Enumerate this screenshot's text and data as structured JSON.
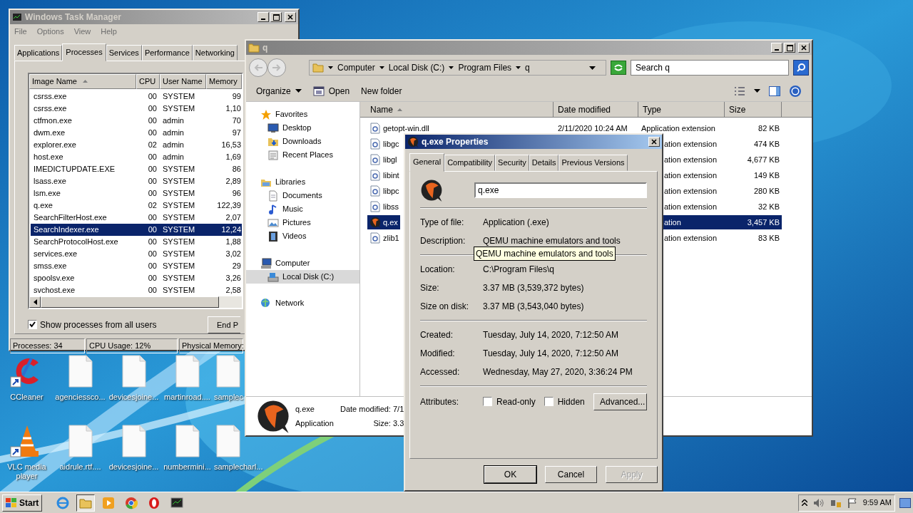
{
  "task_manager": {
    "title": "Windows Task Manager",
    "active": false,
    "menu": [
      "File",
      "Options",
      "View",
      "Help"
    ],
    "tabs": [
      {
        "label": "Applications",
        "selected": false
      },
      {
        "label": "Processes",
        "selected": true
      },
      {
        "label": "Services",
        "selected": false
      },
      {
        "label": "Performance",
        "selected": false
      },
      {
        "label": "Networking",
        "selected": false
      }
    ],
    "columns": [
      "Image Name",
      "CPU",
      "User Name",
      "Memory"
    ],
    "rows": [
      {
        "cells": [
          "csrss.exe",
          "00",
          "SYSTEM",
          "99"
        ],
        "selected": false
      },
      {
        "cells": [
          "csrss.exe",
          "00",
          "SYSTEM",
          "1,10"
        ],
        "selected": false
      },
      {
        "cells": [
          "ctfmon.exe",
          "00",
          "admin",
          "70"
        ],
        "selected": false
      },
      {
        "cells": [
          "dwm.exe",
          "00",
          "admin",
          "97"
        ],
        "selected": false
      },
      {
        "cells": [
          "explorer.exe",
          "02",
          "admin",
          "16,53"
        ],
        "selected": false
      },
      {
        "cells": [
          "host.exe",
          "00",
          "admin",
          "1,69"
        ],
        "selected": false
      },
      {
        "cells": [
          "IMEDICTUPDATE.EXE",
          "00",
          "SYSTEM",
          "86"
        ],
        "selected": false
      },
      {
        "cells": [
          "lsass.exe",
          "00",
          "SYSTEM",
          "2,89"
        ],
        "selected": false
      },
      {
        "cells": [
          "lsm.exe",
          "00",
          "SYSTEM",
          "96"
        ],
        "selected": false
      },
      {
        "cells": [
          "q.exe",
          "02",
          "SYSTEM",
          "122,39"
        ],
        "selected": false
      },
      {
        "cells": [
          "SearchFilterHost.exe",
          "00",
          "SYSTEM",
          "2,07"
        ],
        "selected": false
      },
      {
        "cells": [
          "SearchIndexer.exe",
          "00",
          "SYSTEM",
          "12,24"
        ],
        "selected": true
      },
      {
        "cells": [
          "SearchProtocolHost.exe",
          "00",
          "SYSTEM",
          "1,88"
        ],
        "selected": false
      },
      {
        "cells": [
          "services.exe",
          "00",
          "SYSTEM",
          "3,02"
        ],
        "selected": false
      },
      {
        "cells": [
          "smss.exe",
          "00",
          "SYSTEM",
          "29"
        ],
        "selected": false
      },
      {
        "cells": [
          "spoolsv.exe",
          "00",
          "SYSTEM",
          "3,26"
        ],
        "selected": false
      },
      {
        "cells": [
          "svchost.exe",
          "00",
          "SYSTEM",
          "2,58"
        ],
        "selected": false
      }
    ],
    "show_all_users": {
      "label": "Show processes from all users",
      "checked": true
    },
    "end_button": "End P",
    "status_bar": [
      "Processes: 34",
      "CPU Usage: 12%",
      "Physical Memory:"
    ]
  },
  "explorer": {
    "title": "q",
    "active": false,
    "breadcrumb": [
      "Computer",
      "Local Disk (C:)",
      "Program Files",
      "q"
    ],
    "search": {
      "placeholder": "Search q"
    },
    "toolbar": [
      "Organize",
      "Open",
      "New folder"
    ],
    "nav": [
      {
        "label": "Favorites",
        "kind": "star",
        "selected": false,
        "children": [
          {
            "label": "Desktop",
            "kind": "desktop",
            "selected": false
          },
          {
            "label": "Downloads",
            "kind": "downloads",
            "selected": false
          },
          {
            "label": "Recent Places",
            "kind": "recent",
            "selected": false
          }
        ]
      },
      {
        "label": "Libraries",
        "kind": "library",
        "selected": false,
        "children": [
          {
            "label": "Documents",
            "kind": "document",
            "selected": false
          },
          {
            "label": "Music",
            "kind": "music",
            "selected": false
          },
          {
            "label": "Pictures",
            "kind": "pictures",
            "selected": false
          },
          {
            "label": "Videos",
            "kind": "videos",
            "selected": false
          }
        ]
      },
      {
        "label": "Computer",
        "kind": "computer",
        "selected": false,
        "children": [
          {
            "label": "Local Disk (C:)",
            "kind": "disk",
            "selected": true
          }
        ]
      },
      {
        "label": "Network",
        "kind": "network",
        "selected": false
      }
    ],
    "columns": [
      "Name",
      "Date modified",
      "Type",
      "Size"
    ],
    "files": [
      {
        "name": "getopt-win.dll",
        "date": "2/11/2020 10:24 AM",
        "type": "Application extension",
        "size": "82 KB",
        "kind": "dll",
        "selected": false
      },
      {
        "name": "libgc",
        "type": "ation extension",
        "size": "474 KB",
        "kind": "dll",
        "selected": false
      },
      {
        "name": "libgl",
        "type": "ation extension",
        "size": "4,677 KB",
        "kind": "dll",
        "selected": false
      },
      {
        "name": "libint",
        "type": "ation extension",
        "size": "149 KB",
        "kind": "dll",
        "selected": false
      },
      {
        "name": "libpc",
        "type": "ation extension",
        "size": "280 KB",
        "kind": "dll",
        "selected": false
      },
      {
        "name": "libss",
        "type": "ation extension",
        "size": "32 KB",
        "kind": "dll",
        "selected": false
      },
      {
        "name": "q.ex",
        "type": "ation",
        "size": "3,457 KB",
        "kind": "app",
        "selected": true
      },
      {
        "name": "zlib1",
        "type": "ation extension",
        "size": "83 KB",
        "kind": "dll",
        "selected": false
      }
    ],
    "details": {
      "name": "q.exe",
      "type": "Application",
      "date_modified": "Date modified: 7/1",
      "size": "Size: 3.3"
    }
  },
  "properties": {
    "title": "q.exe Properties",
    "active": true,
    "tabs": [
      {
        "label": "General",
        "selected": true
      },
      {
        "label": "Compatibility",
        "selected": false
      },
      {
        "label": "Security",
        "selected": false
      },
      {
        "label": "Details",
        "selected": false
      },
      {
        "label": "Previous Versions",
        "selected": false
      }
    ],
    "file_name": "q.exe",
    "sections": [
      [
        {
          "label": "Type of file:",
          "value": "Application (.exe)"
        },
        {
          "label": "Description:",
          "value": "QEMU machine emulators and tools"
        }
      ],
      [
        {
          "label": "Location:",
          "value": "C:\\Program Files\\q"
        },
        {
          "label": "Size:",
          "value": "3.37 MB (3,539,372 bytes)"
        },
        {
          "label": "Size on disk:",
          "value": "3.37 MB (3,543,040 bytes)"
        }
      ],
      [
        {
          "label": "Created:",
          "value": "Tuesday, July 14, 2020, 7:12:50 AM"
        },
        {
          "label": "Modified:",
          "value": "Tuesday, July 14, 2020, 7:12:50 AM"
        },
        {
          "label": "Accessed:",
          "value": "Wednesday, May 27, 2020, 3:36:24 PM"
        }
      ]
    ],
    "tooltip": "QEMU machine emulators and tools",
    "attributes": {
      "label": "Attributes:",
      "checkboxes": [
        {
          "label": "Read-only",
          "checked": false
        },
        {
          "label": "Hidden",
          "checked": false
        }
      ],
      "advanced": "Advanced..."
    },
    "buttons": [
      {
        "label": "OK",
        "default": true,
        "disabled": false
      },
      {
        "label": "Cancel",
        "default": false,
        "disabled": false
      },
      {
        "label": "Apply",
        "default": false,
        "disabled": true
      }
    ]
  },
  "desktop_icons": [
    {
      "label": "CCleaner",
      "kind": "ccleaner"
    },
    {
      "label": "agenciessco...",
      "kind": "document"
    },
    {
      "label": "devicesjoine...",
      "kind": "document"
    },
    {
      "label": "martinroad....",
      "kind": "document"
    },
    {
      "label": "samplec",
      "kind": "document"
    },
    {
      "label": "VLC media player",
      "kind": "vlc"
    },
    {
      "label": "aidrule.rtf....",
      "kind": "document"
    },
    {
      "label": "devicesjoine...",
      "kind": "document"
    },
    {
      "label": "numbermini...",
      "kind": "document"
    },
    {
      "label": "samplecharl...",
      "kind": "document"
    }
  ],
  "taskbar": {
    "start": "Start",
    "apps": [
      {
        "kind": "ie",
        "active": false
      },
      {
        "kind": "explorer",
        "active": true
      },
      {
        "kind": "media",
        "active": false
      },
      {
        "kind": "chrome",
        "active": false
      },
      {
        "kind": "opera",
        "active": false
      },
      {
        "kind": "taskmgr",
        "active": false
      }
    ],
    "clock": "9:59 AM"
  }
}
